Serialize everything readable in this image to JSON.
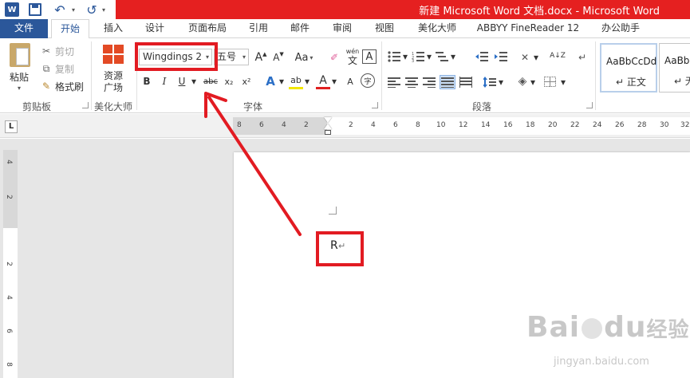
{
  "window": {
    "title": "新建 Microsoft Word 文档.docx - Microsoft Word",
    "app_logo_letter": "W"
  },
  "quick_access": {
    "undo_glyph": "↶",
    "redo_glyph": "↺"
  },
  "tabs": [
    {
      "label": "文件"
    },
    {
      "label": "开始"
    },
    {
      "label": "插入"
    },
    {
      "label": "设计"
    },
    {
      "label": "页面布局"
    },
    {
      "label": "引用"
    },
    {
      "label": "邮件"
    },
    {
      "label": "审阅"
    },
    {
      "label": "视图"
    },
    {
      "label": "美化大师"
    },
    {
      "label": "ABBYY FineReader 12"
    },
    {
      "label": "办公助手"
    }
  ],
  "ribbon": {
    "clipboard": {
      "paste": "粘贴",
      "cut": "剪切",
      "copy": "复制",
      "format_painter": "格式刷",
      "group": "剪贴板"
    },
    "beautify": {
      "resource_line1": "资源",
      "resource_line2": "广场",
      "group": "美化大师"
    },
    "font": {
      "name": "Wingdings 2",
      "size": "五号",
      "grow": "A",
      "shrink": "A",
      "case": "Aa",
      "phonetic_top": "wén",
      "phonetic_bottom": "文",
      "border": "A",
      "bold": "B",
      "italic": "I",
      "underline": "U",
      "strike": "abc",
      "subscript": "x₂",
      "superscript": "x²",
      "effects": "A",
      "highlight": "ab",
      "color": "A",
      "enclose": "字",
      "group": "字体"
    },
    "paragraph": {
      "group": "段落",
      "sort": "A↓Z",
      "marks": "↵"
    },
    "styles": [
      {
        "sample": "AaBbCcDd",
        "name": "正文"
      },
      {
        "sample": "AaBbC",
        "name": "无间"
      }
    ]
  },
  "ruler": {
    "corner": "L",
    "left_ticks": [
      "8",
      "6",
      "4",
      "2"
    ],
    "right_ticks": [
      "2",
      "4",
      "6",
      "8",
      "10",
      "12",
      "14",
      "16",
      "18",
      "20",
      "22",
      "24",
      "26",
      "28",
      "30",
      "32"
    ],
    "vertical_ticks": [
      "4",
      "2",
      "2",
      "4",
      "6",
      "8"
    ]
  },
  "document": {
    "char": "R",
    "paragraph_mark": "↵"
  },
  "watermark": {
    "text_bai": "Bai",
    "text_du": "du",
    "text_jingyan": "经验",
    "url": "jingyan.baidu.com"
  },
  "colors": {
    "title_bar": "#e52020",
    "file_tab": "#2b579a",
    "annotation": "#e21b22"
  }
}
